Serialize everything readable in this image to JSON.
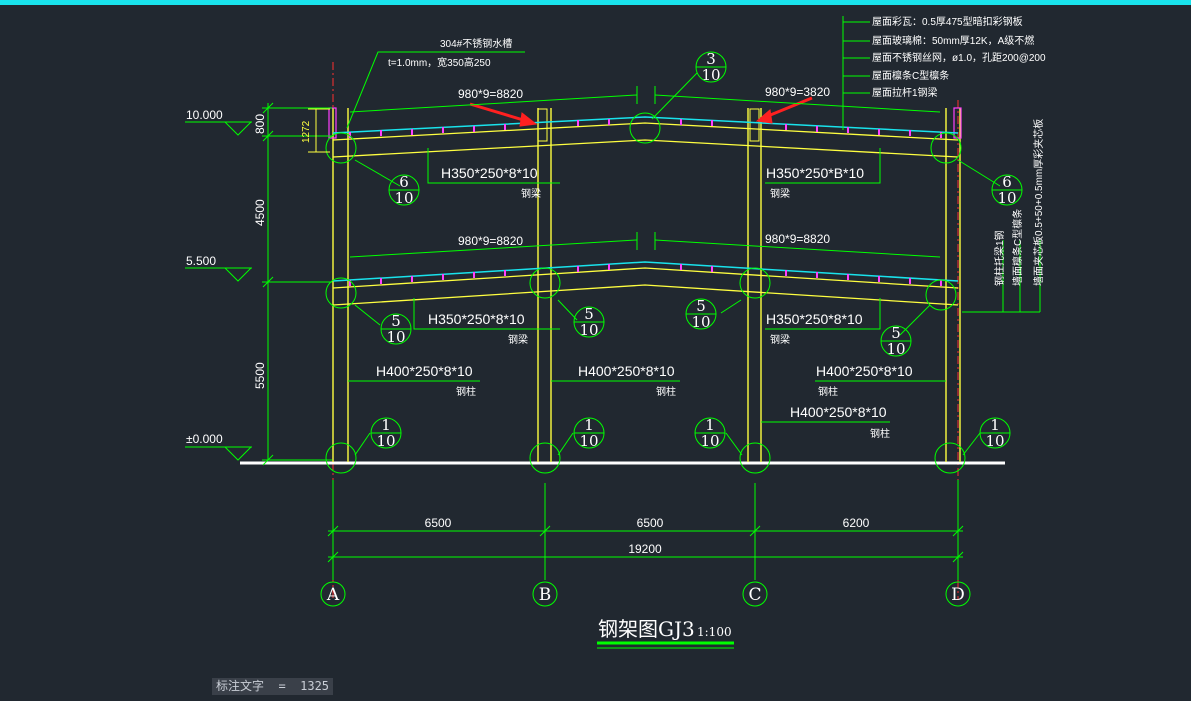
{
  "drawing": {
    "title": "钢架图GJ3",
    "scale": "1:100",
    "elevations": [
      "10.000",
      "5.500",
      "±0.000"
    ],
    "height_dims": [
      "800",
      "4500",
      "5500"
    ],
    "parapet_dim": "1272",
    "span_dims": [
      "6500",
      "6500",
      "6200"
    ],
    "total_dim": "19200",
    "axes": [
      "A",
      "B",
      "C",
      "D"
    ],
    "purlin_spacing": [
      "980*9=8820",
      "980*9=8820",
      "980*9=8820",
      "980*9=3820"
    ],
    "gutter_note": [
      "304#不锈钢水槽",
      "t=1.0mm，宽350高250"
    ],
    "roof_notes": [
      "屋面彩瓦：0.5厚475型暗扣彩钢板",
      "屋面玻璃棉：50mm厚12K，A级不燃",
      "屋面不锈钢丝网，ø1.0，孔距200@200",
      "屋面檩条C型檩条",
      "屋面拉杆1钢梁"
    ],
    "wall_notes": [
      "钢柱托梁1钢",
      "墙面檩条C型檩条",
      "墙面夹芯板0.5+50+0.5mm厚彩夹芯板"
    ],
    "section_labels": {
      "beam": "H350*250*8*10",
      "beam_alt": "H350*250*B*10",
      "column": "H400*250*8*10",
      "beam_caption": "钢梁",
      "column_caption": "钢柱"
    },
    "detail_refs": [
      {
        "num": "3",
        "den": "10"
      },
      {
        "num": "6",
        "den": "10"
      },
      {
        "num": "5",
        "den": "10"
      },
      {
        "num": "1",
        "den": "10"
      }
    ]
  },
  "status_bar": {
    "text": "标注文字  =  1325"
  },
  "colors": {
    "background": "#212830",
    "line": "#00ff00",
    "steel": "#ffff40",
    "roof": "#19e3ec",
    "purlin": "#ff40ff",
    "arrow": "#ff2020",
    "axis_line": "#ff3030"
  }
}
